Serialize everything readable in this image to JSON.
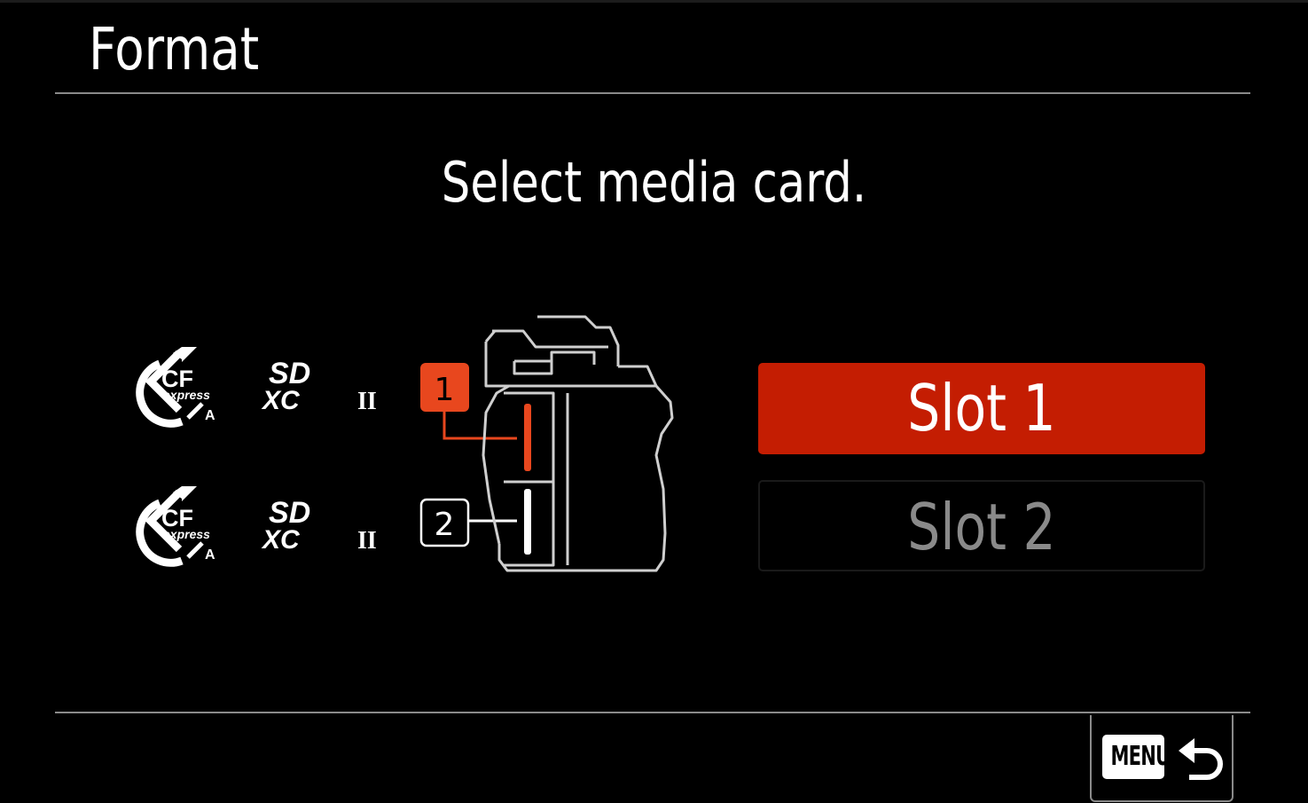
{
  "header": {
    "title": "Format"
  },
  "main": {
    "prompt": "Select media card.",
    "slots": [
      {
        "label": "Slot 1",
        "badge": "1",
        "selected": true,
        "card_types": [
          "CFexpress Type A",
          "SDXC UHS-II"
        ]
      },
      {
        "label": "Slot 2",
        "badge": "2",
        "selected": false,
        "card_types": [
          "CFexpress Type A",
          "SDXC UHS-II"
        ]
      }
    ]
  },
  "card_logos": {
    "cf_line1": "CF",
    "cf_line2": "express",
    "cf_type": "A",
    "sd_line1": "SD",
    "sd_line2": "XC",
    "uhs": "II"
  },
  "footer": {
    "menu_key": "MENU",
    "back_icon": "return-arrow-icon"
  },
  "colors": {
    "accent": "#c41d02",
    "badge_orange": "#e8471e",
    "background": "#000000",
    "divider": "#8a8a8a",
    "inactive_text": "#8a8a8a"
  }
}
